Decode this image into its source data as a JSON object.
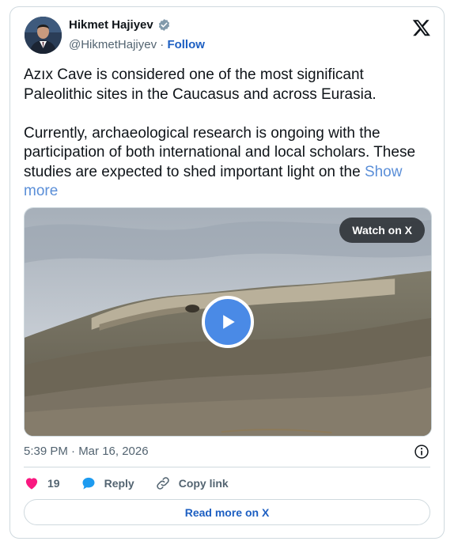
{
  "author": {
    "name": "Hikmet Hajiyev",
    "handle": "@HikmetHajiyev",
    "separator": "·",
    "follow_label": "Follow"
  },
  "tweet": {
    "text": "Azıx Cave is considered one of the most significant Paleolithic sites in the Caucasus and across Eurasia.\n\nCurrently, archaeological research is ongoing with the participation of both international and local scholars. These studies are expected to shed important light on the ",
    "show_more_label": "Show more"
  },
  "media": {
    "watch_label": "Watch on X"
  },
  "meta": {
    "timestamp": "5:39 PM · Mar 16, 2026"
  },
  "actions": {
    "likes": "19",
    "reply_label": "Reply",
    "copy_link_label": "Copy link"
  },
  "footer": {
    "read_more_label": "Read more on X"
  },
  "colors": {
    "like": "#f91880",
    "reply": "#1d9bf0",
    "link_blue": "#1d5fc2",
    "play_button": "#4a8ae6"
  }
}
